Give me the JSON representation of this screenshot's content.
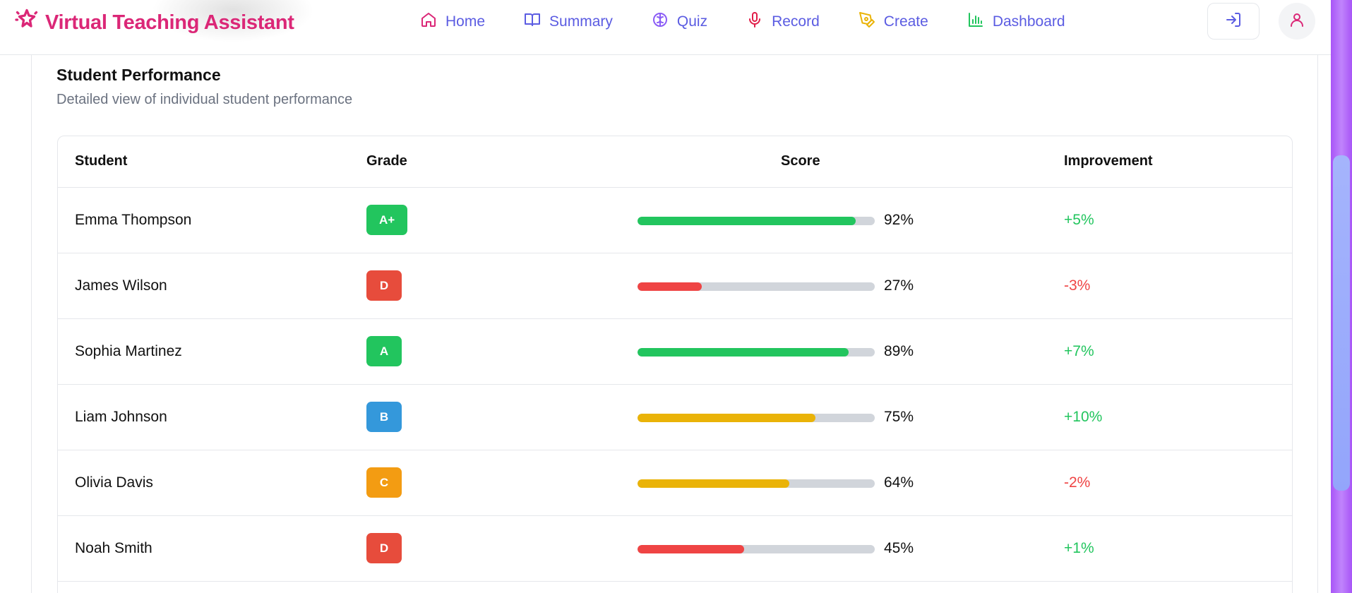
{
  "header": {
    "brand": "Virtual Teaching Assistant",
    "nav": [
      {
        "label": "Home",
        "icon": "home-icon",
        "color": "#db2777"
      },
      {
        "label": "Summary",
        "icon": "book-open-icon",
        "color": "#5b5ce2"
      },
      {
        "label": "Quiz",
        "icon": "brain-icon",
        "color": "#8b5cf6"
      },
      {
        "label": "Record",
        "icon": "microphone-icon",
        "color": "#e11d48"
      },
      {
        "label": "Create",
        "icon": "pen-tool-icon",
        "color": "#eab308"
      },
      {
        "label": "Dashboard",
        "icon": "bar-chart-icon",
        "color": "#22c55e"
      }
    ]
  },
  "section": {
    "title": "Student Performance",
    "subtitle": "Detailed view of individual student performance"
  },
  "table": {
    "headers": {
      "student": "Student",
      "grade": "Grade",
      "score": "Score",
      "improvement": "Improvement"
    },
    "rows": [
      {
        "name": "Emma Thompson",
        "grade": "A+",
        "grade_color": "#22c55e",
        "score": 92,
        "score_label": "92%",
        "bar_color": "#22c55e",
        "improvement": "+5%",
        "improvement_color": "#22c55e"
      },
      {
        "name": "James Wilson",
        "grade": "D",
        "grade_color": "#e74c3c",
        "score": 27,
        "score_label": "27%",
        "bar_color": "#ef4444",
        "improvement": "-3%",
        "improvement_color": "#ef4444"
      },
      {
        "name": "Sophia Martinez",
        "grade": "A",
        "grade_color": "#22c55e",
        "score": 89,
        "score_label": "89%",
        "bar_color": "#22c55e",
        "improvement": "+7%",
        "improvement_color": "#22c55e"
      },
      {
        "name": "Liam Johnson",
        "grade": "B",
        "grade_color": "#3498db",
        "score": 75,
        "score_label": "75%",
        "bar_color": "#eab308",
        "improvement": "+10%",
        "improvement_color": "#22c55e"
      },
      {
        "name": "Olivia Davis",
        "grade": "C",
        "grade_color": "#f39c12",
        "score": 64,
        "score_label": "64%",
        "bar_color": "#eab308",
        "improvement": "-2%",
        "improvement_color": "#ef4444"
      },
      {
        "name": "Noah Smith",
        "grade": "D",
        "grade_color": "#e74c3c",
        "score": 45,
        "score_label": "45%",
        "bar_color": "#ef4444",
        "improvement": "+1%",
        "improvement_color": "#22c55e"
      }
    ]
  },
  "colors": {
    "brand": "#db2777",
    "nav_text": "#5b5ce2",
    "scroll_track": "#a855f7",
    "scroll_thumb": "#a5b4fc"
  }
}
